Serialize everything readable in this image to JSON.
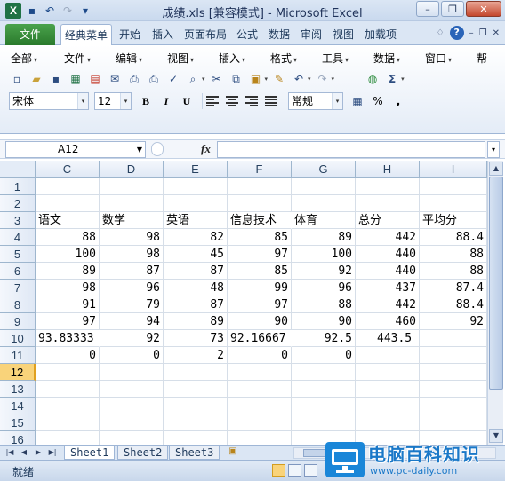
{
  "window": {
    "title": "成绩.xls  [兼容模式] - Microsoft Excel"
  },
  "qat": {
    "icons": [
      "excel-logo",
      "save-icon",
      "undo-icon",
      "redo-icon",
      "customize-icon"
    ]
  },
  "ribbon_tabs": {
    "file": "文件",
    "items": [
      "经典菜单",
      "开始",
      "插入",
      "页面布局",
      "公式",
      "数据",
      "审阅",
      "视图",
      "加载项"
    ]
  },
  "classic_menu": {
    "items": [
      "全部",
      "文件",
      "编辑",
      "视图",
      "插入",
      "格式",
      "工具",
      "数据",
      "窗口",
      "帮"
    ]
  },
  "format_bar": {
    "font": "宋体",
    "size": "12",
    "bold": "B",
    "italic": "I",
    "underline": "U",
    "number_format": "常规",
    "percent": "%",
    "comma": ","
  },
  "formula_bar": {
    "name_box": "A12",
    "fx": "fx",
    "formula": ""
  },
  "grid": {
    "columns": [
      "C",
      "D",
      "E",
      "F",
      "G",
      "H",
      "I"
    ],
    "rows": [
      "1",
      "2",
      "3",
      "4",
      "5",
      "6",
      "7",
      "8",
      "9",
      "10",
      "11",
      "12",
      "13",
      "14",
      "15",
      "16"
    ],
    "selected_row": "12",
    "header_row": [
      "语文",
      "数学",
      "英语",
      "信息技术",
      "体育",
      "总分",
      "平均分"
    ],
    "data": [
      [
        "88",
        "98",
        "82",
        "85",
        "89",
        "442",
        "88.4"
      ],
      [
        "100",
        "98",
        "45",
        "97",
        "100",
        "440",
        "88"
      ],
      [
        "89",
        "87",
        "87",
        "85",
        "92",
        "440",
        "88"
      ],
      [
        "98",
        "96",
        "48",
        "99",
        "96",
        "437",
        "87.4"
      ],
      [
        "91",
        "79",
        "87",
        "97",
        "88",
        "442",
        "88.4"
      ],
      [
        "97",
        "94",
        "89",
        "90",
        "90",
        "460",
        "92"
      ],
      [
        "93.83333",
        "92",
        "73",
        "92.16667",
        "92.5",
        "443.5",
        ""
      ],
      [
        "0",
        "0",
        "2",
        "0",
        "0",
        "",
        ""
      ]
    ]
  },
  "sheets": [
    "Sheet1",
    "Sheet2",
    "Sheet3"
  ],
  "active_sheet": "Sheet1",
  "status": {
    "text": "就绪"
  },
  "watermark": {
    "title": "电脑百科知识",
    "url": "www.pc-daily.com"
  }
}
